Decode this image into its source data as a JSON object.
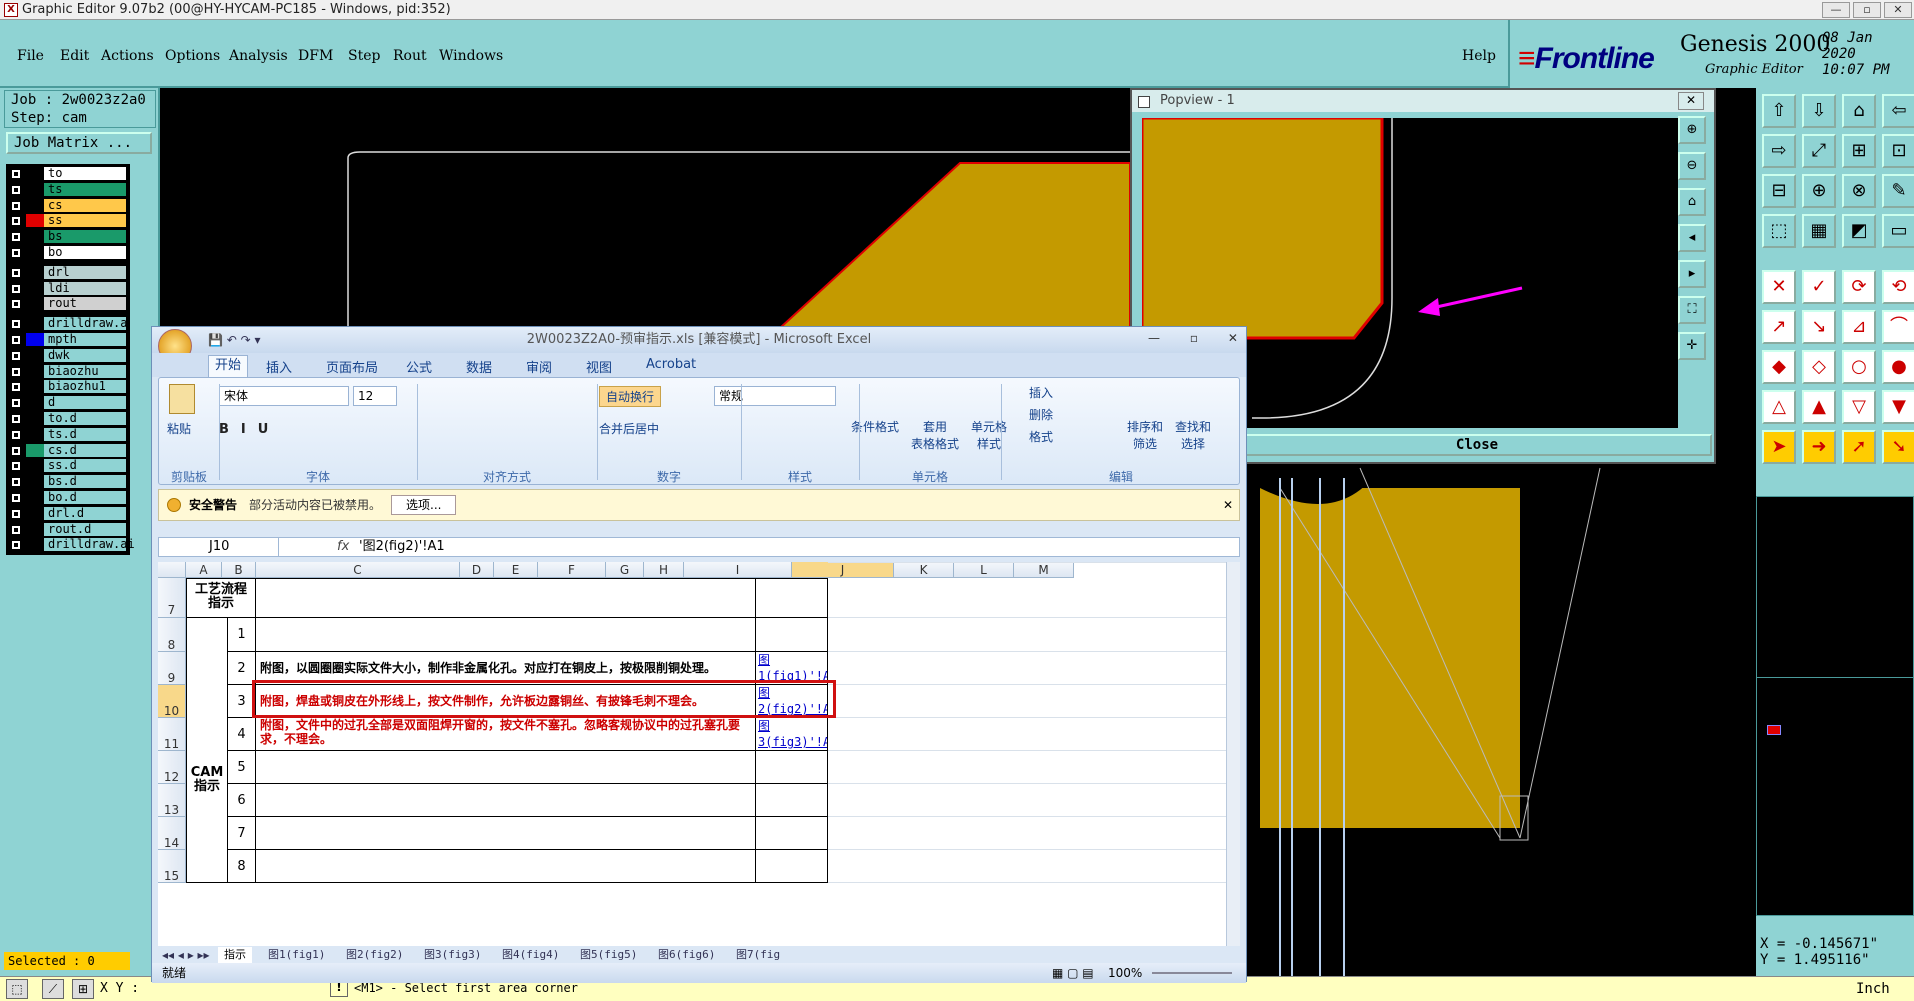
{
  "genesis": {
    "window_title": "Graphic Editor 9.07b2 (00@HY-HYCAM-PC185 - Windows, pid:352)",
    "menu": [
      "File",
      "Edit",
      "Actions",
      "Options",
      "Analysis",
      "DFM",
      "Step",
      "Rout",
      "Windows"
    ],
    "help": "Help",
    "brand": "Frontline",
    "product": "Genesis 2000",
    "subtitle": "Graphic Editor",
    "date": "08 Jan 2020",
    "time": "10:07 PM",
    "job_label": "Job : 2w0023z2a0",
    "step_label": "Step: cam",
    "job_matrix": "Job Matrix ...",
    "layers": [
      {
        "name": "to",
        "color": "#ffffff",
        "sw": "#000000"
      },
      {
        "name": "ts",
        "color": "#1a9a6a",
        "sw": "#000000"
      },
      {
        "name": "cs",
        "color": "#ffc84a",
        "sw": "#000000"
      },
      {
        "name": "ss",
        "color": "#ffc84a",
        "sw": "#e00000"
      },
      {
        "name": "bs",
        "color": "#1a9a6a",
        "sw": "#000000"
      },
      {
        "name": "bo",
        "color": "#ffffff",
        "sw": "#000000"
      },
      {
        "name": "drl",
        "color": "#b8d0d0",
        "sw": "#000000"
      },
      {
        "name": "ldi",
        "color": "#b8d0d0",
        "sw": "#000000"
      },
      {
        "name": "rout",
        "color": "#d0d0d0",
        "sw": "#000000"
      },
      {
        "name": "drilldraw.a",
        "color": "#8fd3d3",
        "sw": "#000000"
      },
      {
        "name": "mpth",
        "color": "#8fd3d3",
        "sw": "#0000ee"
      },
      {
        "name": "dwk",
        "color": "#8fd3d3",
        "sw": "#000000"
      },
      {
        "name": "biaozhu",
        "color": "#8fd3d3",
        "sw": "#000000"
      },
      {
        "name": "biaozhu1",
        "color": "#8fd3d3",
        "sw": "#000000"
      },
      {
        "name": "d",
        "color": "#8fd3d3",
        "sw": "#000000"
      },
      {
        "name": "to.d",
        "color": "#8fd3d3",
        "sw": "#000000"
      },
      {
        "name": "ts.d",
        "color": "#8fd3d3",
        "sw": "#000000"
      },
      {
        "name": "cs.d",
        "color": "#8fd3d3",
        "sw": "#1a9a6a"
      },
      {
        "name": "ss.d",
        "color": "#8fd3d3",
        "sw": "#000000"
      },
      {
        "name": "bs.d",
        "color": "#8fd3d3",
        "sw": "#000000"
      },
      {
        "name": "bo.d",
        "color": "#8fd3d3",
        "sw": "#000000"
      },
      {
        "name": "drl.d",
        "color": "#8fd3d3",
        "sw": "#000000"
      },
      {
        "name": "rout.d",
        "color": "#8fd3d3",
        "sw": "#000000"
      },
      {
        "name": "drilldraw.ai",
        "color": "#8fd3d3",
        "sw": "#000000"
      }
    ],
    "selected": "Selected : 0",
    "xy_label": "X Y :",
    "prompt": "<M1> - Select first area corner",
    "units": "Inch",
    "coord_x": "X = -0.145671\"",
    "coord_y": "Y =  1.495116\"",
    "popview_title": "Popview - 1",
    "popview_close": "Close"
  },
  "excel": {
    "title": "2W0023Z2A0-预审指示.xls  [兼容模式] - Microsoft Excel",
    "tabs": [
      "开始",
      "插入",
      "页面布局",
      "公式",
      "数据",
      "审阅",
      "视图",
      "Acrobat"
    ],
    "font": "宋体",
    "font_size": "12",
    "number_format": "常规",
    "groups": [
      "剪贴板",
      "字体",
      "对齐方式",
      "数字",
      "样式",
      "单元格",
      "编辑"
    ],
    "buttons": {
      "paste": "粘贴",
      "wrap": "自动换行",
      "merge": "合并后居中",
      "cond": "条件格式",
      "table": "套用\n表格格式",
      "cellstyle": "单元格\n样式",
      "insert": "插入",
      "delete": "删除",
      "format": "格式",
      "sort": "排序和\n筛选",
      "find": "查找和\n选择"
    },
    "warning_title": "安全警告",
    "warning_text": "部分活动内容已被禁用。",
    "warning_btn": "选项...",
    "namebox": "J10",
    "formula": "'图2(fig2)'!A1",
    "columns": [
      "A",
      "B",
      "C",
      "D",
      "E",
      "F",
      "G",
      "H",
      "I",
      "J",
      "K",
      "L",
      "M"
    ],
    "rows": [
      "7",
      "8",
      "9",
      "10",
      "11",
      "12",
      "13",
      "14",
      "15"
    ],
    "header_cell": "工艺流程\n指示",
    "cam_label": "CAM\n指示",
    "items": [
      {
        "no": "1",
        "text": "",
        "link": ""
      },
      {
        "no": "2",
        "text": "附图，以圆圈圈实际文件大小，制作非金属化孔。对应打在铜皮上，按极限削铜处理。",
        "link": "图1(fig1)'!A"
      },
      {
        "no": "3",
        "text": "附图，焊盘或铜皮在外形线上，按文件制作，允许板边露铜丝、有披锋毛刺不理会。",
        "link": "图2(fig2)'!A"
      },
      {
        "no": "4",
        "text": "附图，文件中的过孔全部是双面阻焊开窗的，按文件不塞孔。忽略客规协议中的过孔塞孔要求，不理会。",
        "link": "图3(fig3)'!A"
      },
      {
        "no": "5",
        "text": "",
        "link": ""
      },
      {
        "no": "6",
        "text": "",
        "link": ""
      },
      {
        "no": "7",
        "text": "",
        "link": ""
      },
      {
        "no": "8",
        "text": "",
        "link": ""
      }
    ],
    "sheet_tabs": [
      "指示",
      "图1(fig1)",
      "图2(fig2)",
      "图3(fig3)",
      "图4(fig4)",
      "图5(fig5)",
      "图6(fig6)",
      "图7(fig"
    ],
    "status": "就绪",
    "zoom": "100%"
  },
  "colors": {
    "teal": "#8fd3d3",
    "copper": "#c49a00",
    "magenta": "#ff00ff",
    "red": "#e00000"
  }
}
